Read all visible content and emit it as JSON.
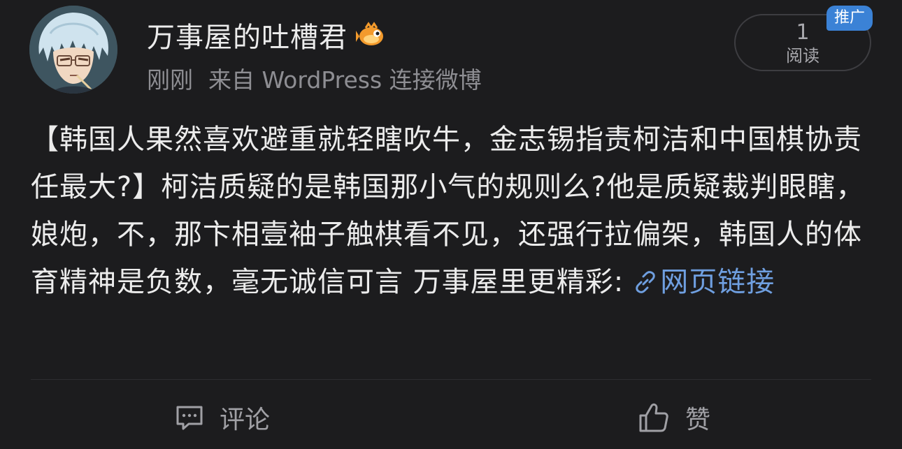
{
  "post": {
    "username": "万事屋的吐槽君",
    "time": "刚刚",
    "source": "来自 WordPress 连接微博",
    "read_count": "1",
    "read_label": "阅读",
    "promo_badge": "推广",
    "body_text": "【韩国人果然喜欢避重就轻瞎吹牛，金志锡指责柯洁和中国棋协责任最大?】柯洁质疑的是韩国那小气的规则么?他是质疑裁判眼瞎，娘炮，不，那卞相壹袖子触棋看不见，还强行拉偏架，韩国人的体育精神是负数，毫无诚信可言 万事屋里更精彩:",
    "link_text": "网页链接",
    "link_icon": "link-icon",
    "avatar_icon": "avatar-icon",
    "vip_icon": "vip-fish-badge-icon"
  },
  "actions": {
    "comment_label": "评论",
    "comment_icon": "comment-icon",
    "like_label": "赞",
    "like_icon": "thumbs-up-icon"
  },
  "colors": {
    "background": "#1c1c1e",
    "primary_text": "#ececec",
    "secondary_text": "#8e8e93",
    "link": "#6f9fe0",
    "promo_badge": "#3b82d6"
  }
}
